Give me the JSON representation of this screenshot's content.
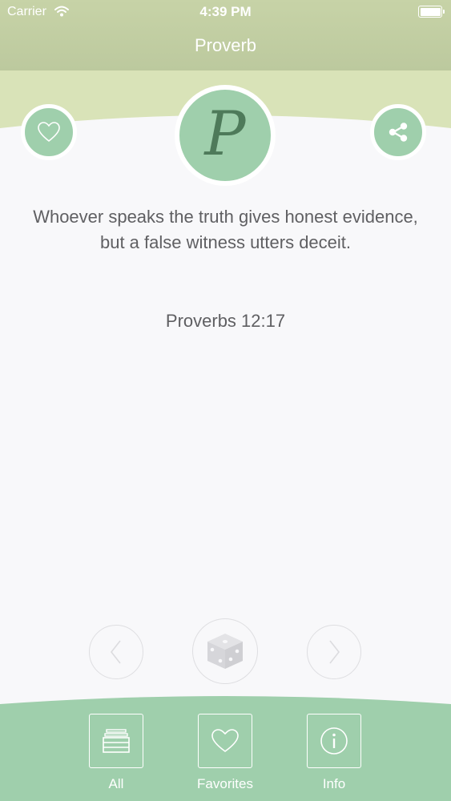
{
  "status_bar": {
    "carrier": "Carrier",
    "time": "4:39 PM"
  },
  "nav": {
    "title": "Proverb"
  },
  "logo": {
    "letter": "P"
  },
  "proverb": {
    "text": "Whoever speaks the truth gives honest evidence, but a false witness utters deceit.",
    "reference": "Proverbs 12:17"
  },
  "controls": {
    "icons": [
      "chevron-left-icon",
      "dice-icon",
      "chevron-right-icon"
    ]
  },
  "tabs": [
    {
      "label": "All",
      "icon": "archive-icon"
    },
    {
      "label": "Favorites",
      "icon": "heart-icon"
    },
    {
      "label": "Info",
      "icon": "info-icon"
    }
  ],
  "colors": {
    "header": "#bcc99e",
    "header_wave": "#d9e3b8",
    "accent_green": "#9fcfac",
    "logo_letter": "#4e7a5a",
    "tabbar": "#9fcfac",
    "background": "#f8f8fa",
    "text": "#5f5f62"
  }
}
